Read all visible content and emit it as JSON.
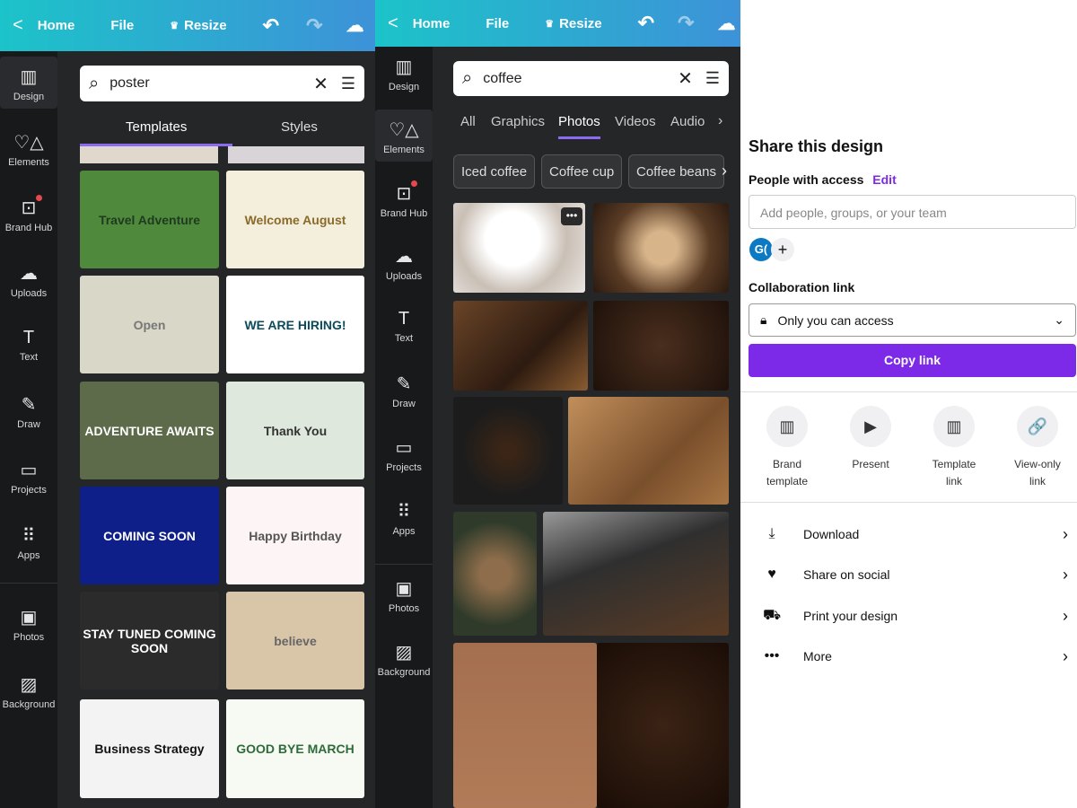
{
  "panel1": {
    "topbar": {
      "back": "<",
      "home": "Home",
      "file": "File",
      "resize": "Resize"
    },
    "sidebar": [
      {
        "label": "Design",
        "icon": "▥"
      },
      {
        "label": "Elements",
        "icon": "♡△"
      },
      {
        "label": "Brand Hub",
        "icon": "⊡"
      },
      {
        "label": "Uploads",
        "icon": "☁"
      },
      {
        "label": "Text",
        "icon": "T"
      },
      {
        "label": "Draw",
        "icon": "✎"
      },
      {
        "label": "Projects",
        "icon": "▭"
      },
      {
        "label": "Apps",
        "icon": "⠿"
      },
      {
        "label": "Photos",
        "icon": "▣"
      },
      {
        "label": "Background",
        "icon": "▨"
      }
    ],
    "search": {
      "value": "poster"
    },
    "tabs": [
      "Templates",
      "Styles"
    ],
    "templates": [
      {
        "text": "Travel Adventure",
        "bg": "#4f8a3c",
        "fg": "#1f3a20"
      },
      {
        "text": "Welcome August",
        "bg": "#f3efdc",
        "fg": "#8a6a2a"
      },
      {
        "text": "Open",
        "bg": "#d9d7c8",
        "fg": "#777"
      },
      {
        "text": "WE ARE HIRING!",
        "bg": "#ffffff",
        "fg": "#0b4b5c"
      },
      {
        "text": "ADVENTURE AWAITS",
        "bg": "#5d6b4a",
        "fg": "#ffffff"
      },
      {
        "text": "Thank You",
        "bg": "#dfe8dc",
        "fg": "#333"
      },
      {
        "text": "COMING SOON",
        "bg": "#0f1f8a",
        "fg": "#ffffff"
      },
      {
        "text": "Happy Birthday",
        "bg": "#fdf4f6",
        "fg": "#555"
      },
      {
        "text": "STAY TUNED COMING SOON",
        "bg": "#2b2b2b",
        "fg": "#ffffff"
      },
      {
        "text": "believe",
        "bg": "#d9c6a8",
        "fg": "#666"
      },
      {
        "text": "Business Strategy",
        "bg": "#f3f3f3",
        "fg": "#111"
      },
      {
        "text": "GOOD BYE MARCH",
        "bg": "#f7faf3",
        "fg": "#2e6b3a"
      }
    ]
  },
  "panel2": {
    "topbar": {
      "back": "<",
      "home": "Home",
      "file": "File",
      "resize": "Resize"
    },
    "sidebar": [
      {
        "label": "Design",
        "icon": "▥"
      },
      {
        "label": "Elements",
        "icon": "♡△"
      },
      {
        "label": "Brand Hub",
        "icon": "⊡"
      },
      {
        "label": "Uploads",
        "icon": "☁"
      },
      {
        "label": "Text",
        "icon": "T"
      },
      {
        "label": "Draw",
        "icon": "✎"
      },
      {
        "label": "Projects",
        "icon": "▭"
      },
      {
        "label": "Apps",
        "icon": "⠿"
      },
      {
        "label": "Photos",
        "icon": "▣"
      },
      {
        "label": "Background",
        "icon": "▨"
      }
    ],
    "search": {
      "value": "coffee"
    },
    "tabs": [
      "All",
      "Graphics",
      "Photos",
      "Videos",
      "Audio"
    ],
    "active_tab": "Photos",
    "chips": [
      "Iced coffee",
      "Coffee cup",
      "Coffee beans"
    ]
  },
  "share": {
    "title": "Share this design",
    "people_label": "People with access",
    "edit": "Edit",
    "add_placeholder": "Add people, groups, or your team",
    "avatar": "G(",
    "collab_label": "Collaboration link",
    "access": "Only you can access",
    "copy": "Copy link",
    "options": [
      {
        "label": "Brand template",
        "icon": "▥"
      },
      {
        "label": "Present",
        "icon": "▶"
      },
      {
        "label": "Template link",
        "icon": "▥"
      },
      {
        "label": "View-only link",
        "icon": "🔗"
      }
    ],
    "rows": [
      {
        "label": "Download",
        "icon": "⤓"
      },
      {
        "label": "Share on social",
        "icon": "♥"
      },
      {
        "label": "Print your design",
        "icon": "⛟"
      },
      {
        "label": "More",
        "icon": "•••"
      }
    ],
    "accent": "#7d2ae8"
  }
}
